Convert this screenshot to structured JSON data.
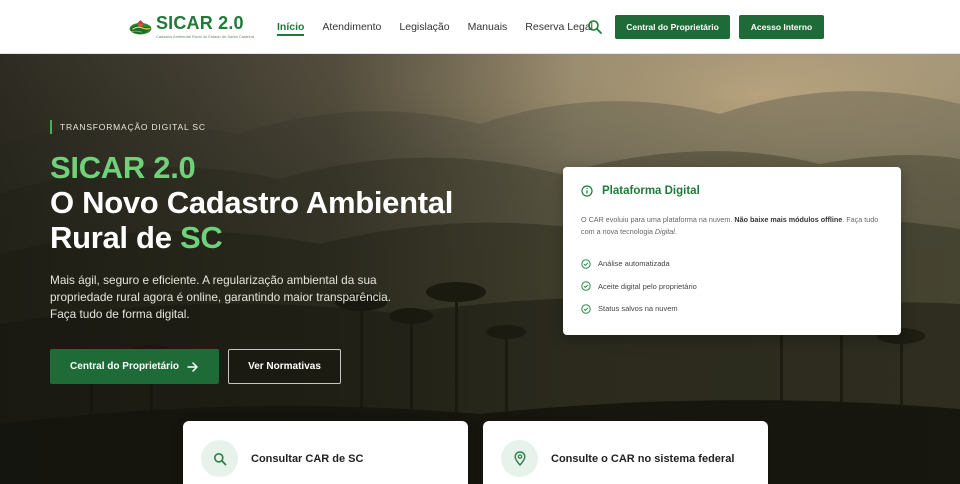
{
  "header": {
    "logo": {
      "title": "SICAR 2.0",
      "subtitle": "Cadastro Ambiental Rural do Estado de Santa Catarina"
    },
    "nav": [
      {
        "label": "Início",
        "active": true
      },
      {
        "label": "Atendimento",
        "active": false
      },
      {
        "label": "Legislação",
        "active": false
      },
      {
        "label": "Manuais",
        "active": false
      },
      {
        "label": "Reserva Legal",
        "active": false
      }
    ],
    "central_label": "Central do Proprietário",
    "acesso_label": "Acesso Interno"
  },
  "hero": {
    "eyebrow": "TRANSFORMAÇÃO DIGITAL SC",
    "title_line1": "SICAR 2.0",
    "title_line2": "O Novo Cadastro Ambiental",
    "title_line3_prefix": "Rural de ",
    "title_line3_accent": "SC",
    "description": "Mais ágil, seguro e eficiente. A regularização ambiental da sua propriedade rural agora é online, garantindo maior transparência. Faça tudo de forma digital.",
    "cta_primary": "Central do Proprietário",
    "cta_secondary": "Ver Normativas"
  },
  "platform_card": {
    "title": "Plataforma Digital",
    "desc_part1": "O CAR evoluiu para uma plataforma na nuvem. ",
    "desc_bold": "Não baixe mais módulos offline",
    "desc_part2": ". Faça tudo com a nova tecnologia ",
    "desc_italic": "Digital",
    "desc_end": ".",
    "items": [
      "Análise automatizada",
      "Aceite digital pelo proprietário",
      "Status salvos na nuvem"
    ]
  },
  "cards": [
    {
      "label": "Consultar CAR de SC",
      "icon": "search-icon"
    },
    {
      "label": "Consulte o CAR no sistema federal",
      "icon": "map-pin-icon"
    }
  ],
  "colors": {
    "brand_green": "#1e6b37",
    "accent_green": "#6fd27a",
    "text_green": "#1f7a3a"
  }
}
